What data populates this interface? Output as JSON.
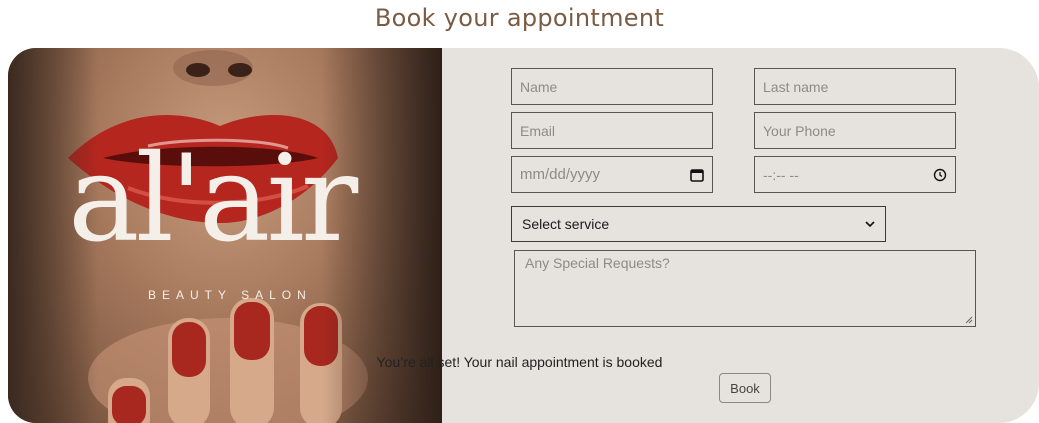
{
  "header": {
    "title": "Book your appointment"
  },
  "branding": {
    "logo_word": "al'air",
    "logo_tagline": "BEAUTY SALON"
  },
  "form": {
    "name_placeholder": "Name",
    "lastname_placeholder": "Last name",
    "email_placeholder": "Email",
    "phone_placeholder": "Your Phone",
    "date_placeholder": "mm/dd/yyyy",
    "time_placeholder": "--:-- --",
    "service_selected": "Select service",
    "requests_placeholder": "Any Special Requests?",
    "status_message": "You’re all set! Your nail appointment is booked",
    "book_label": "Book"
  },
  "colors": {
    "title": "#7a5c44",
    "panel": "#e6e2dd",
    "border": "#5a5550"
  },
  "icons": {
    "date": "calendar-icon",
    "time": "clock-icon",
    "select": "chevron-down-icon"
  }
}
